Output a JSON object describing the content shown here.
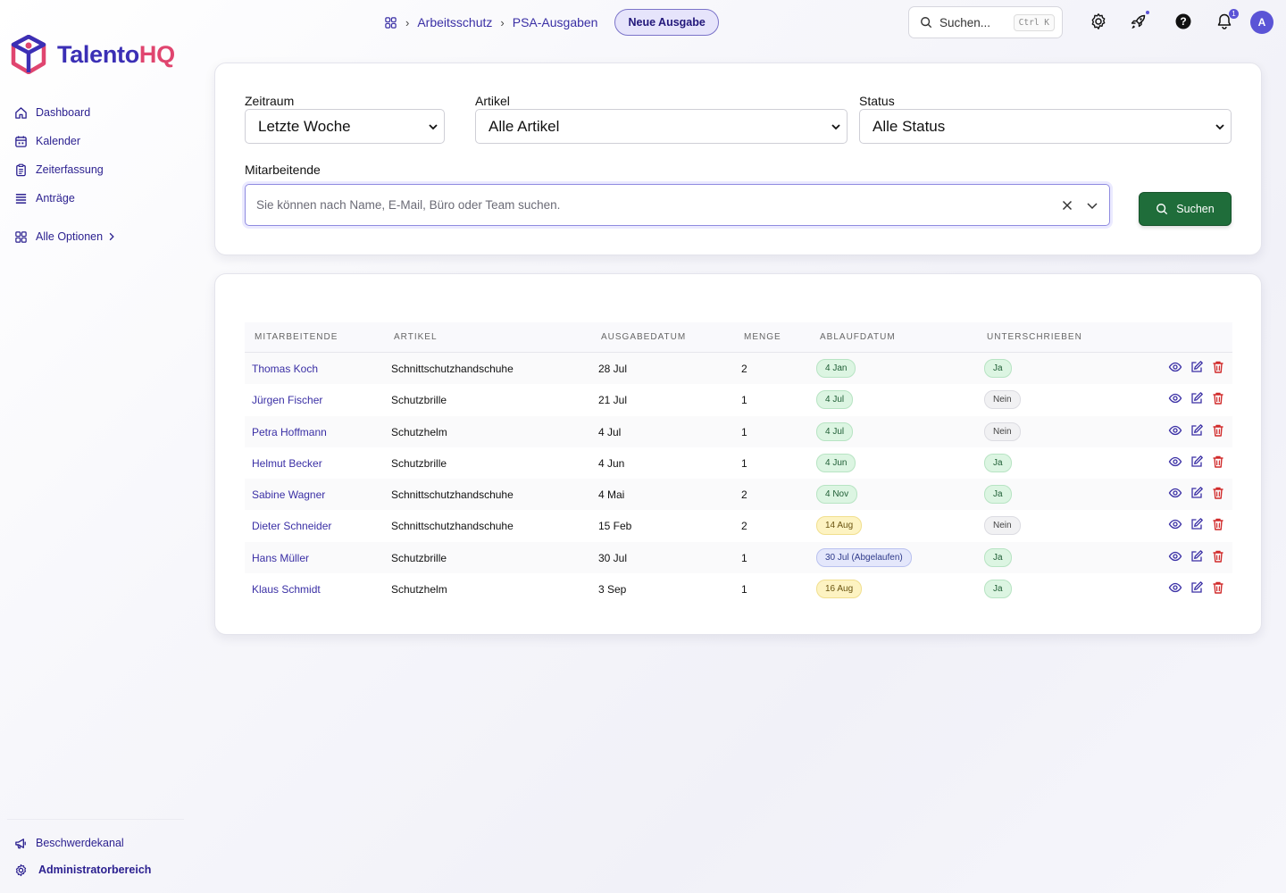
{
  "brand": {
    "name_part1": "Talento",
    "name_part2": "HQ",
    "primary": "#3b2fb5",
    "accent": "#e0456f"
  },
  "sidebar": {
    "items": [
      {
        "label": "Dashboard",
        "icon": "home-icon"
      },
      {
        "label": "Kalender",
        "icon": "calendar-icon"
      },
      {
        "label": "Zeiterfassung",
        "icon": "clipboard-icon"
      },
      {
        "label": "Anträge",
        "icon": "list-icon"
      }
    ],
    "all_options": "Alle Optionen",
    "bottom": [
      {
        "label": "Beschwerdekanal",
        "icon": "megaphone-icon"
      },
      {
        "label": "Administratorbereich",
        "icon": "gear-icon"
      }
    ]
  },
  "header": {
    "breadcrumb": [
      "Arbeitsschutz",
      "PSA-Ausgaben"
    ],
    "new_button": "Neue Ausgabe",
    "search_placeholder": "Suchen...",
    "search_shortcut": "Ctrl K",
    "notification_count": "1",
    "avatar_initial": "A"
  },
  "filters": {
    "period_label": "Zeitraum",
    "period_value": "Letzte Woche",
    "article_label": "Artikel",
    "article_value": "Alle Artikel",
    "status_label": "Status",
    "status_value": "Alle Status",
    "employees_label": "Mitarbeitende",
    "employees_placeholder": "Sie können nach Name, E-Mail, Büro oder Team suchen.",
    "search_button": "Suchen"
  },
  "table": {
    "headers": [
      "Mitarbeitende",
      "Artikel",
      "Ausgabedatum",
      "Menge",
      "Ablaufdatum",
      "Unterschrieben"
    ],
    "rows": [
      {
        "name": "Thomas Koch",
        "item": "Schnittschutzhandschuhe",
        "issued": "28 Jul",
        "qty": "2",
        "expiry": "4 Jan",
        "expiry_status": "green",
        "signed": "Ja",
        "signed_status": "green"
      },
      {
        "name": "Jürgen Fischer",
        "item": "Schutzbrille",
        "issued": "21 Jul",
        "qty": "1",
        "expiry": "4 Jul",
        "expiry_status": "green",
        "signed": "Nein",
        "signed_status": "grey"
      },
      {
        "name": "Petra Hoffmann",
        "item": "Schutzhelm",
        "issued": "4 Jul",
        "qty": "1",
        "expiry": "4 Jul",
        "expiry_status": "green",
        "signed": "Nein",
        "signed_status": "grey"
      },
      {
        "name": "Helmut Becker",
        "item": "Schutzbrille",
        "issued": "4 Jun",
        "qty": "1",
        "expiry": "4 Jun",
        "expiry_status": "green",
        "signed": "Ja",
        "signed_status": "green"
      },
      {
        "name": "Sabine Wagner",
        "item": "Schnittschutzhandschuhe",
        "issued": "4 Mai",
        "qty": "2",
        "expiry": "4 Nov",
        "expiry_status": "green",
        "signed": "Ja",
        "signed_status": "green"
      },
      {
        "name": "Dieter Schneider",
        "item": "Schnittschutzhandschuhe",
        "issued": "15 Feb",
        "qty": "2",
        "expiry": "14 Aug",
        "expiry_status": "yellow",
        "signed": "Nein",
        "signed_status": "grey"
      },
      {
        "name": "Hans Müller",
        "item": "Schutzbrille",
        "issued": "30 Jul",
        "qty": "1",
        "expiry": "30 Jul (Abgelaufen)",
        "expiry_status": "blue",
        "signed": "Ja",
        "signed_status": "green"
      },
      {
        "name": "Klaus Schmidt",
        "item": "Schutzhelm",
        "issued": "3 Sep",
        "qty": "1",
        "expiry": "16 Aug",
        "expiry_status": "yellow",
        "signed": "Ja",
        "signed_status": "green"
      }
    ]
  }
}
